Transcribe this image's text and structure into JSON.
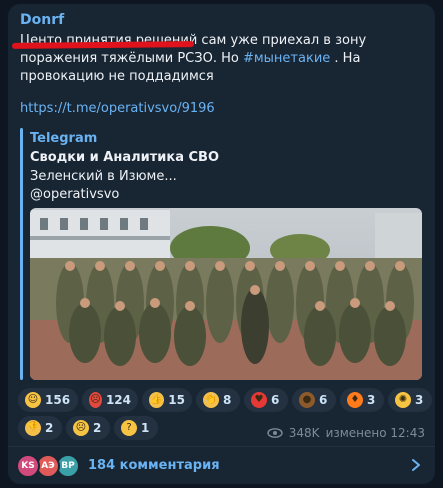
{
  "message": {
    "author": "Donrf",
    "text_parts": {
      "main": "Центо принятия решений сам уже приехал в зону поражения тяжёлыми РСЗО. Но",
      "hashtag": "#мынетакие",
      "tail": ". На провокацию не поддадимся"
    },
    "link": "https://t.me/operativsvo/9196"
  },
  "preview": {
    "site_name": "Telegram",
    "title": "Сводки и Аналитика СВО",
    "description": "Зеленский в Изюме...",
    "handle": "@operativsvo"
  },
  "reactions": [
    {
      "icon": "grinning-face-icon",
      "count": "156",
      "color": "#f6c343"
    },
    {
      "icon": "angry-face-icon",
      "count": "124",
      "color": "#e2483d"
    },
    {
      "icon": "thumbs-up-icon",
      "count": "15",
      "color": "#f4c04a"
    },
    {
      "icon": "clapping-hands-icon",
      "count": "8",
      "color": "#f4c04a"
    },
    {
      "icon": "red-heart-icon",
      "count": "6",
      "color": "#e53935"
    },
    {
      "icon": "pile-of-poo-icon",
      "count": "6",
      "color": "#8d5a2b"
    },
    {
      "icon": "fire-icon",
      "count": "3",
      "color": "#ff7a1a"
    },
    {
      "icon": "exploding-head-icon",
      "count": "3",
      "color": "#f6c343"
    },
    {
      "icon": "thumbs-down-icon",
      "count": "2",
      "color": "#f4c04a"
    },
    {
      "icon": "crying-face-icon",
      "count": "2",
      "color": "#f6c343"
    },
    {
      "icon": "thinking-face-icon",
      "count": "1",
      "color": "#f6c343"
    }
  ],
  "meta": {
    "views": "348K",
    "edited": "изменено 12:43"
  },
  "comments": {
    "avatars": [
      {
        "initials": "KS",
        "color": "#d04b7c"
      },
      {
        "initials": "АЭ",
        "color": "#e05a5a"
      },
      {
        "initials": "ВР",
        "color": "#3aa0a8"
      }
    ],
    "label": "184 комментария"
  },
  "colors": {
    "background": "#0e1621",
    "bubble": "#182533",
    "accent": "#6ab3f3",
    "annotation_underline": "#e0121b"
  }
}
